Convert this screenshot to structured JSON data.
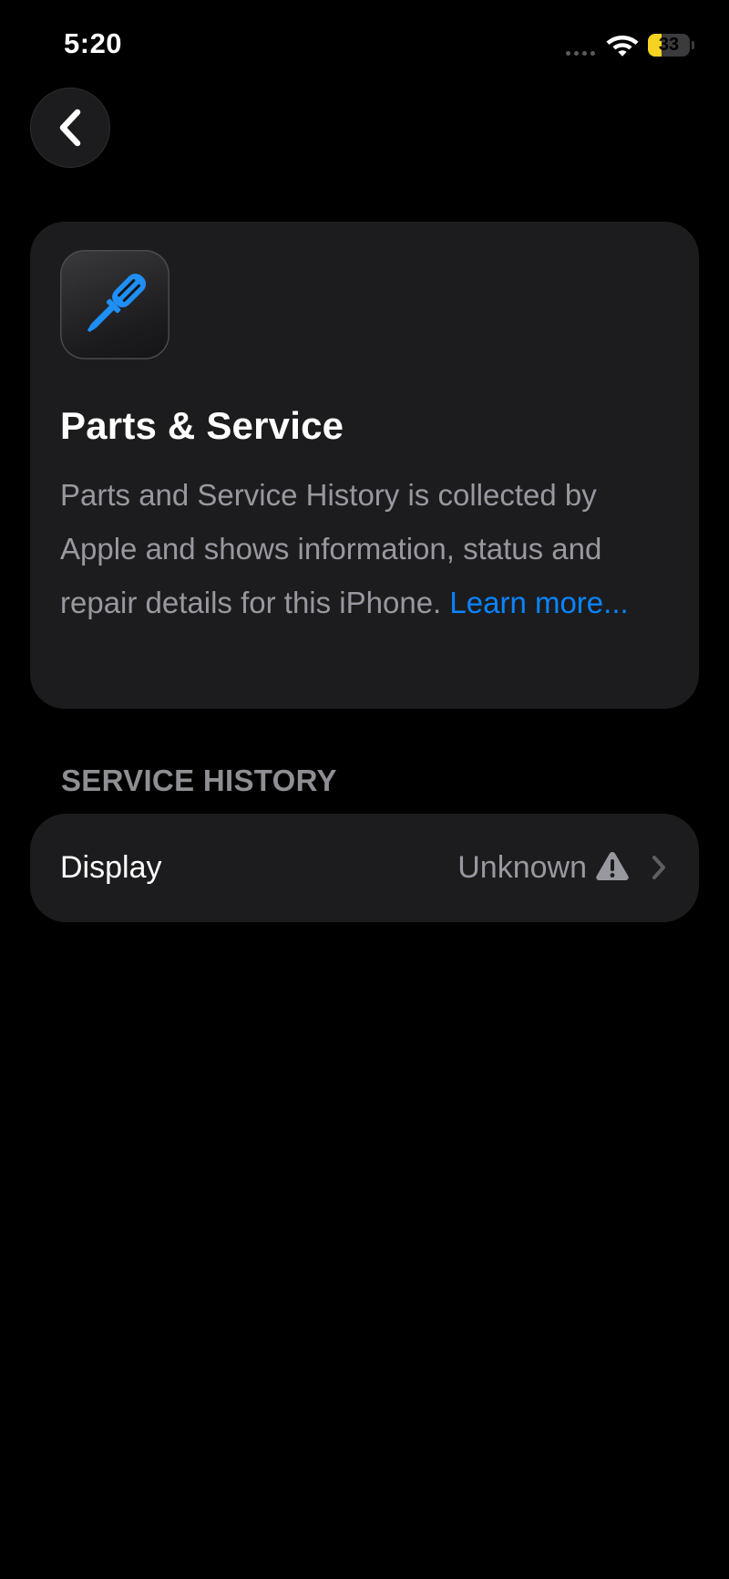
{
  "status_bar": {
    "time": "5:20",
    "battery_level": "33",
    "battery_fraction": 0.33
  },
  "navigation": {
    "back_icon": "chevron-left-icon"
  },
  "info_card": {
    "icon": "screwdriver-icon",
    "title": "Parts & Service",
    "description": "Parts and Service History is collected by Apple and shows information, status and repair details for this iPhone. ",
    "link_text": "Learn more..."
  },
  "service_history": {
    "section_title": "SERVICE HISTORY",
    "rows": [
      {
        "label": "Display",
        "value": "Unknown",
        "status_icon": "warning-icon"
      }
    ]
  },
  "colors": {
    "background": "#000000",
    "card": "#1c1c1e",
    "accent": "#0a84ff",
    "secondary_text": "#98989f",
    "battery": "#f4d21f"
  }
}
